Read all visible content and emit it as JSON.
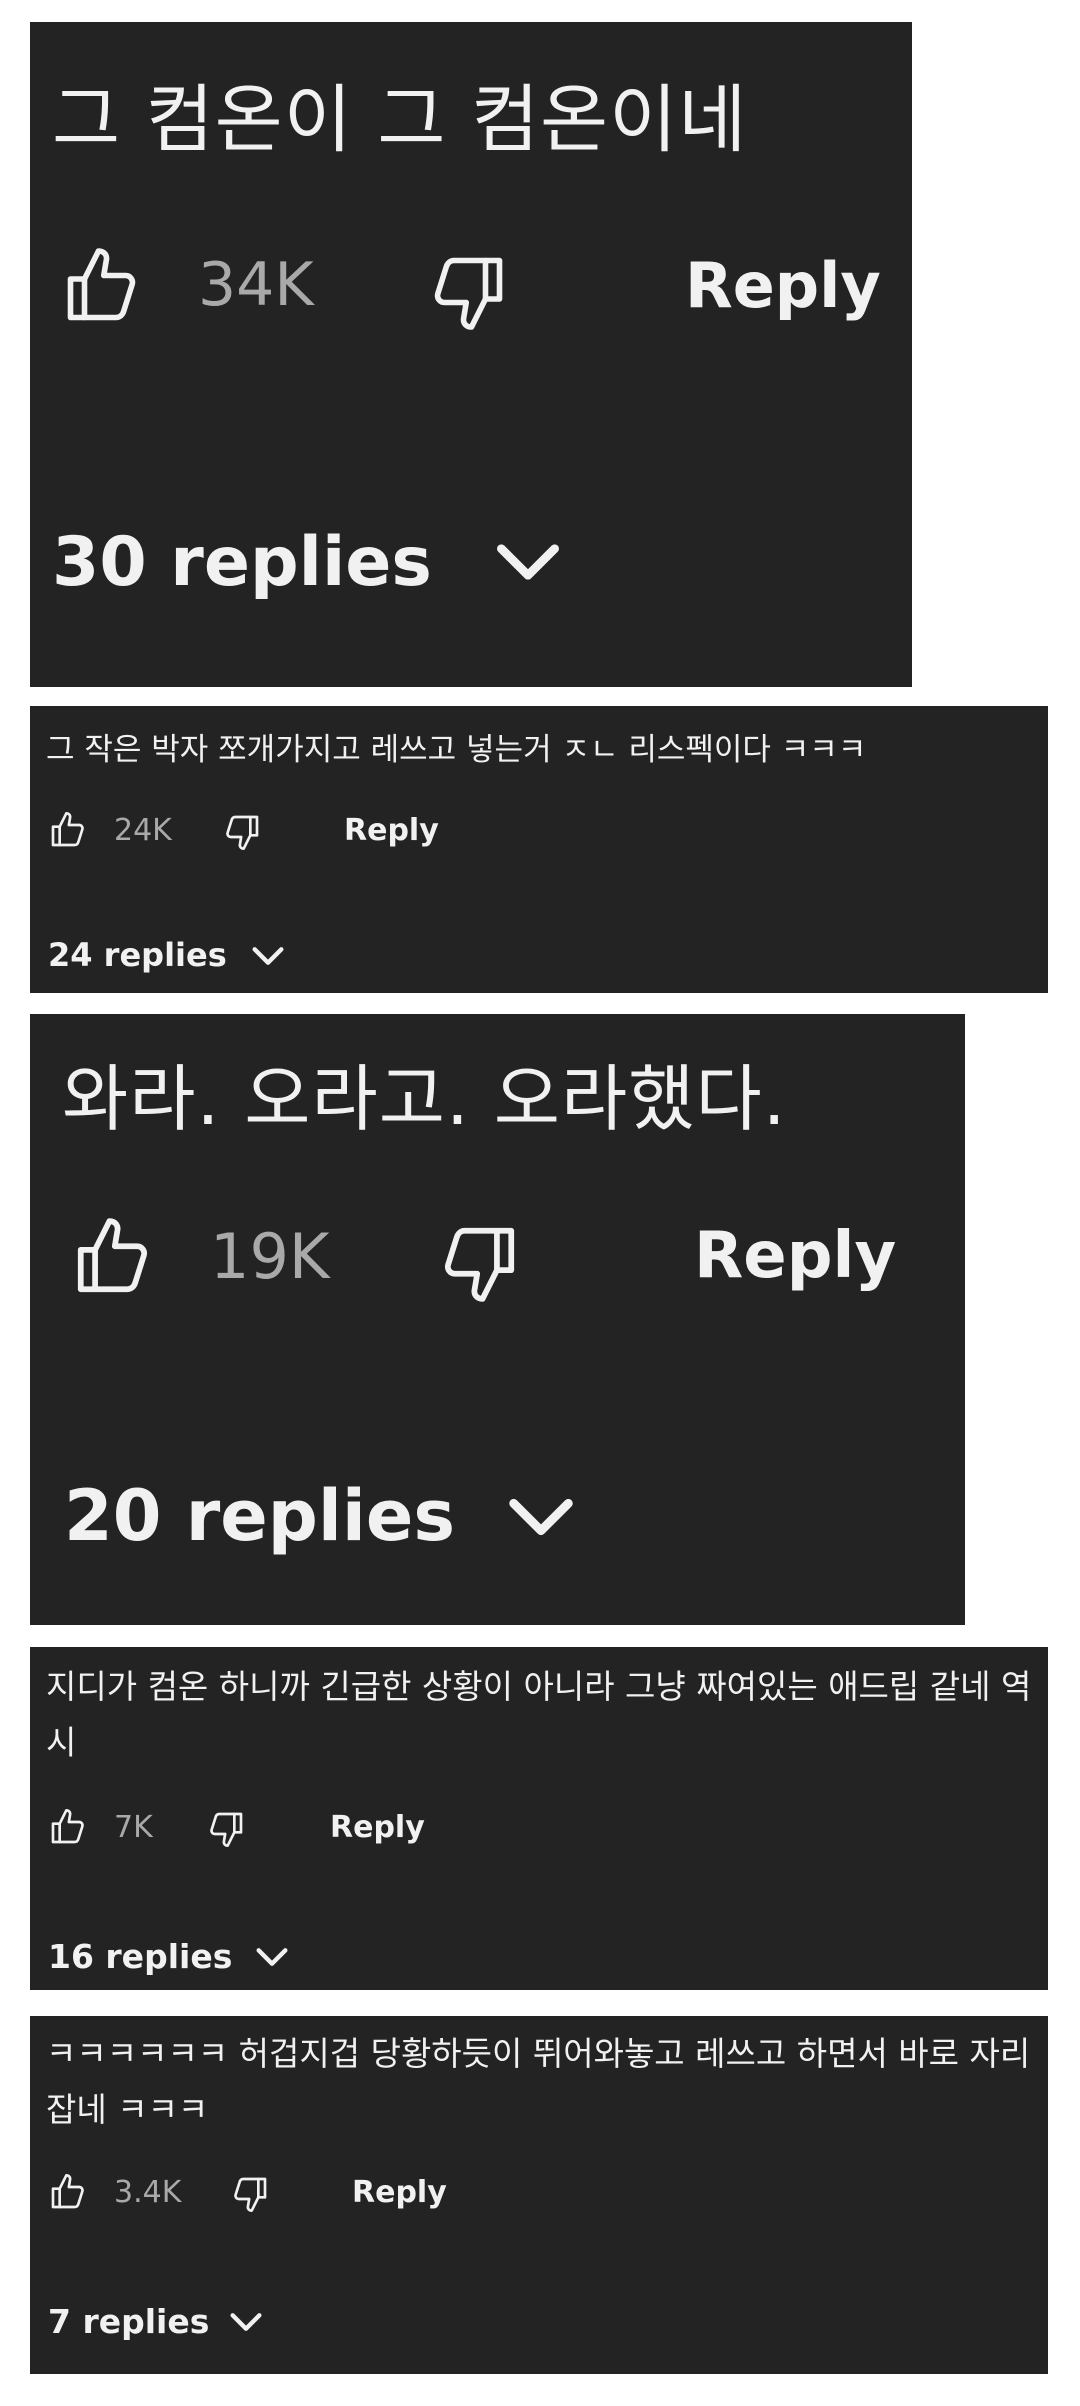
{
  "comments": [
    {
      "text": "그 컴온이 그 컴온이네",
      "likes": "34K",
      "reply_label": "Reply",
      "replies_label": "30 replies"
    },
    {
      "text": "그 작은 박자 쪼개가지고 레쓰고 넣는거 ㅈㄴ 리스펙이다 ㅋㅋㅋ",
      "likes": "24K",
      "reply_label": "Reply",
      "replies_label": "24 replies"
    },
    {
      "text": "와라. 오라고. 오라했다.",
      "likes": "19K",
      "reply_label": "Reply",
      "replies_label": "20 replies"
    },
    {
      "text": "지디가 컴온 하니까 긴급한 상황이 아니라 그냥 짜여있는 애드립 같네 역시",
      "likes": "7K",
      "reply_label": "Reply",
      "replies_label": "16 replies"
    },
    {
      "text": "ㅋㅋㅋㅋㅋㅋ 허겁지겁 당황하듯이 뛰어와놓고 레쓰고 하면서 바로 자리잡네 ㅋㅋㅋ",
      "likes": "3.4K",
      "reply_label": "Reply",
      "replies_label": "7 replies"
    }
  ],
  "colors": {
    "card_background": "#232323",
    "text": "#f1f1f1",
    "muted": "#a9a9a9",
    "page_background": "#ffffff"
  },
  "icons": {
    "like": "thumbs-up-icon",
    "dislike": "thumbs-down-icon",
    "expand": "chevron-down-icon"
  }
}
